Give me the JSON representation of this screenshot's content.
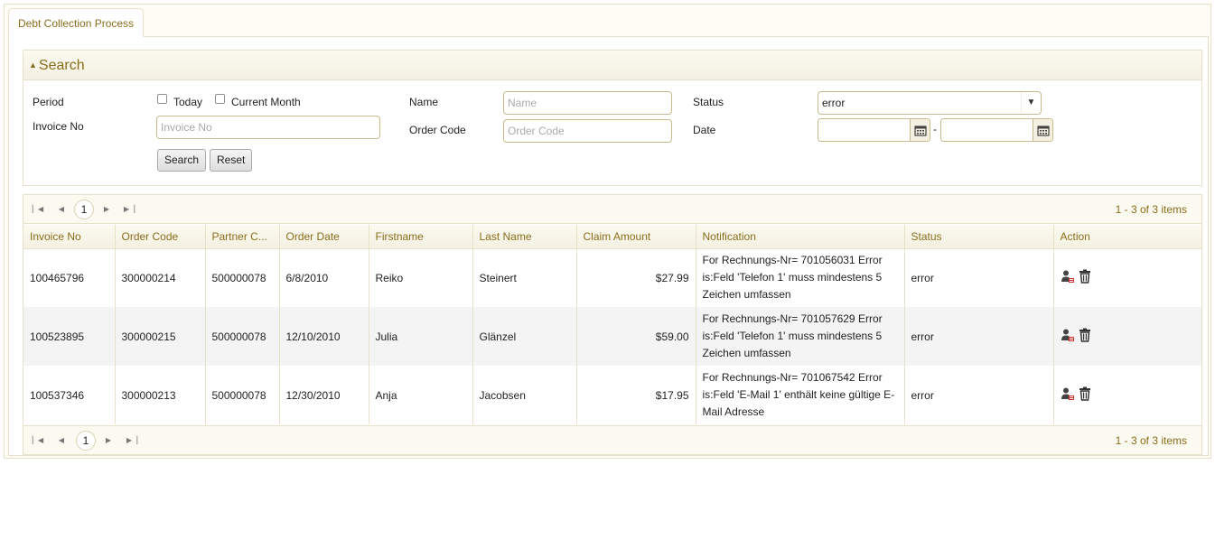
{
  "tab": {
    "label": "Debt Collection Process"
  },
  "search": {
    "title": "Search",
    "period_label": "Period",
    "today_label": "Today",
    "current_month_label": "Current Month",
    "invoice_no_label": "Invoice No",
    "invoice_no_placeholder": "Invoice No",
    "name_label": "Name",
    "name_placeholder": "Name",
    "order_code_label": "Order Code",
    "order_code_placeholder": "Order Code",
    "status_label": "Status",
    "status_value": "error",
    "date_label": "Date",
    "date_separator": "-",
    "search_button": "Search",
    "reset_button": "Reset"
  },
  "pager": {
    "page": "1",
    "info": "1 - 3 of 3 items"
  },
  "grid": {
    "columns": [
      "Invoice No",
      "Order Code",
      "Partner C...",
      "Order Date",
      "Firstname",
      "Last Name",
      "Claim Amount",
      "Notification",
      "Status",
      "Action"
    ],
    "rows": [
      {
        "invoice_no": "100465796",
        "order_code": "300000214",
        "partner_code": "500000078",
        "order_date": "6/8/2010",
        "firstname": "Reiko",
        "last_name": "Steinert",
        "claim_amount": "$27.99",
        "notification": "For Rechnungs-Nr= 701056031 Error is:Feld 'Telefon 1' muss mindestens 5 Zeichen umfassen",
        "status": "error"
      },
      {
        "invoice_no": "100523895",
        "order_code": "300000215",
        "partner_code": "500000078",
        "order_date": "12/10/2010",
        "firstname": "Julia",
        "last_name": "Glänzel",
        "claim_amount": "$59.00",
        "notification": "For Rechnungs-Nr= 701057629 Error is:Feld 'Telefon 1' muss mindestens 5 Zeichen umfassen",
        "status": "error"
      },
      {
        "invoice_no": "100537346",
        "order_code": "300000213",
        "partner_code": "500000078",
        "order_date": "12/30/2010",
        "firstname": "Anja",
        "last_name": "Jacobsen",
        "claim_amount": "$17.95",
        "notification": "For Rechnungs-Nr= 701067542 Error is:Feld 'E-Mail 1' enthält keine gültige E-Mail Adresse",
        "status": "error"
      }
    ]
  },
  "icons": {
    "user_action": "user-remove-icon",
    "delete_action": "trash-icon",
    "calendar": "calendar-icon"
  },
  "colors": {
    "accent": "#8a6d1c",
    "border": "#e6e1c8",
    "header_bg": "#f4f1e2",
    "alt_row": "#f4f4f4"
  }
}
